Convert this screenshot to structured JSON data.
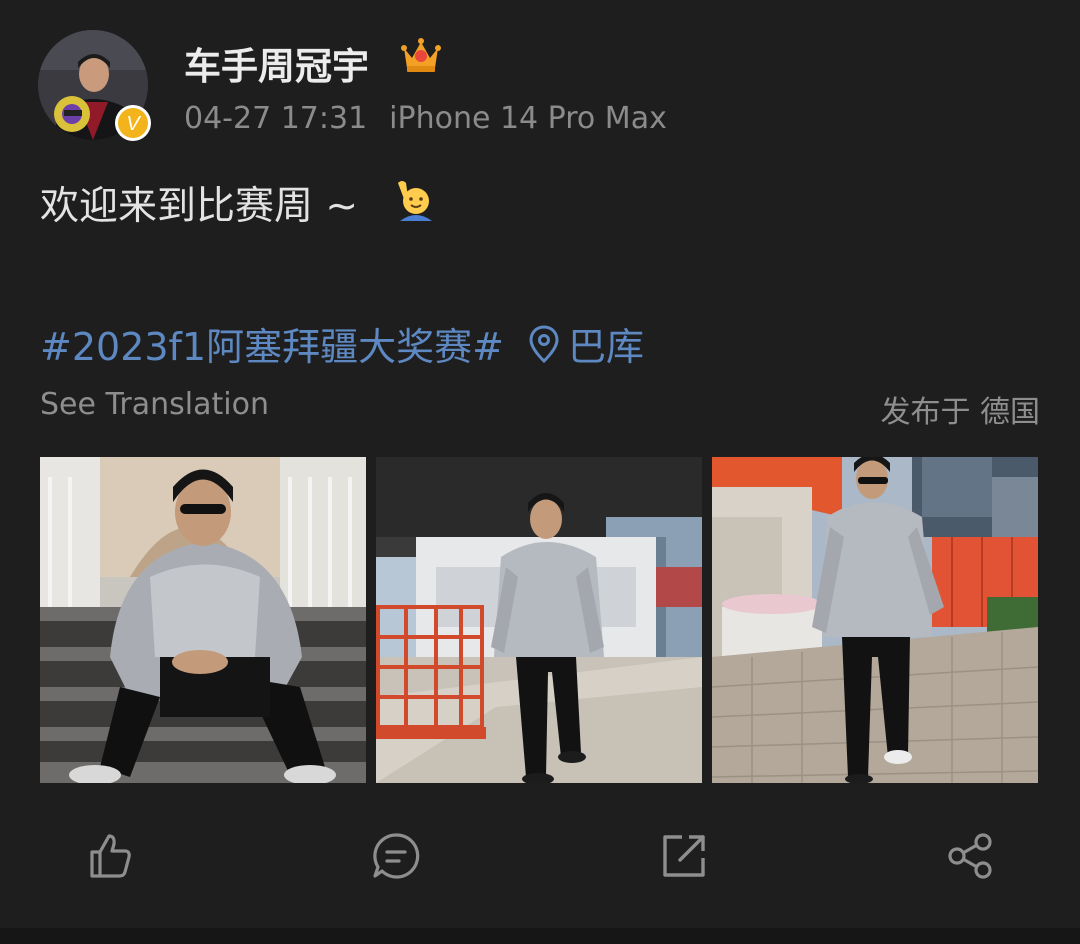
{
  "post": {
    "username": "车手周冠宇",
    "timestamp": "04-27 17:31",
    "device": "iPhone 14 Pro Max",
    "text": "欢迎来到比赛周 ~",
    "topic": "#2023f1阿塞拜疆大奖赛#",
    "location": "巴库",
    "see_translation": "See Translation",
    "published_from": "发布于 德国",
    "verified_badge_letter": "V",
    "icons": {
      "vip": "crown-icon",
      "emoji": "raising-hand-emoji",
      "location": "location-pin-icon"
    }
  },
  "photos": [
    {
      "name": "photo-seated-on-stairs",
      "description_icon": "photo"
    },
    {
      "name": "photo-walking-paddock-gate",
      "description_icon": "photo"
    },
    {
      "name": "photo-walking-brick-path",
      "description_icon": "photo"
    }
  ],
  "actions": [
    {
      "name": "like-button",
      "icon": "thumbs-up-icon"
    },
    {
      "name": "comment-button",
      "icon": "comment-icon"
    },
    {
      "name": "repost-button",
      "icon": "repost-icon"
    },
    {
      "name": "share-button",
      "icon": "share-icon"
    }
  ],
  "colors": {
    "background": "#1e1e1e",
    "text": "#e3e3e3",
    "meta": "#8b8b8b",
    "link": "#5d88c2",
    "verified": "#f3b41b"
  }
}
